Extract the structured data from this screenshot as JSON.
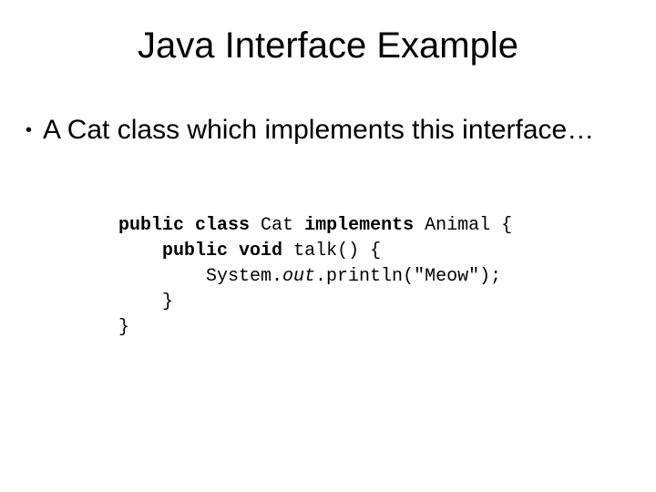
{
  "title": "Java Interface Example",
  "bullet": {
    "marker": "•",
    "text": "A Cat class which implements this interface…"
  },
  "code": {
    "kw_public1": "public",
    "kw_class": "class",
    "txt_cat": " Cat ",
    "kw_implements": "implements",
    "txt_animal": " Animal {",
    "indent1": "    ",
    "kw_public2": "public",
    "kw_void": "void",
    "txt_talk": " talk() {",
    "indent2": "        ",
    "txt_system": "System.",
    "it_out": "out",
    "txt_println": ".println(\"Meow\");",
    "brace_close1": "    }",
    "brace_close2": "}"
  }
}
